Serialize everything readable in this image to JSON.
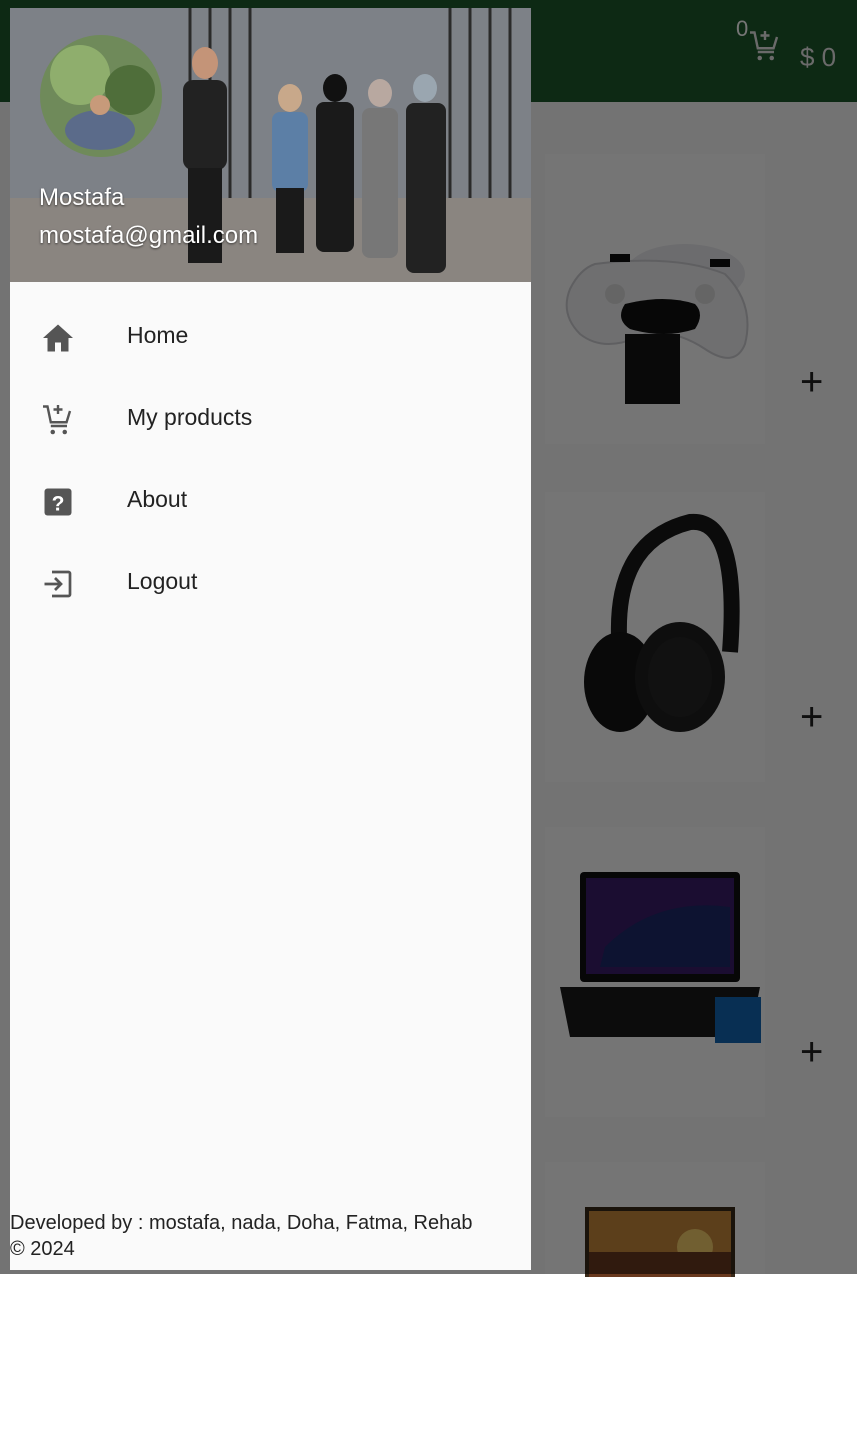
{
  "app_bar": {
    "cart_count": "0",
    "cart_total": "$ 0",
    "cart_icon": "add-shopping-cart-icon"
  },
  "products": [
    {
      "name": "controller",
      "image": "ps5-controllers-image",
      "add_icon": "plus-icon",
      "add_label": "+"
    },
    {
      "name": "headphones",
      "image": "headphones-image",
      "add_icon": "plus-icon",
      "add_label": "+"
    },
    {
      "name": "laptop",
      "image": "laptop-image",
      "add_icon": "plus-icon",
      "add_label": "+"
    },
    {
      "name": "monitor",
      "image": "monitor-image"
    }
  ],
  "drawer": {
    "account": {
      "name": "Mostafa",
      "email": "mostafa@gmail.com"
    },
    "items": [
      {
        "label": "Home",
        "icon": "home-icon"
      },
      {
        "label": "My products",
        "icon": "add-shopping-cart-icon"
      },
      {
        "label": "About",
        "icon": "help-icon"
      },
      {
        "label": "Logout",
        "icon": "logout-icon"
      }
    ],
    "footer": {
      "credits": "Developed by : mostafa, nada, Doha, Fatma, Rehab",
      "copyright": "© 2024"
    }
  },
  "colors": {
    "app_bar": "#1e5a2c",
    "drawer_bg": "#fafafa",
    "icon": "#555555"
  }
}
